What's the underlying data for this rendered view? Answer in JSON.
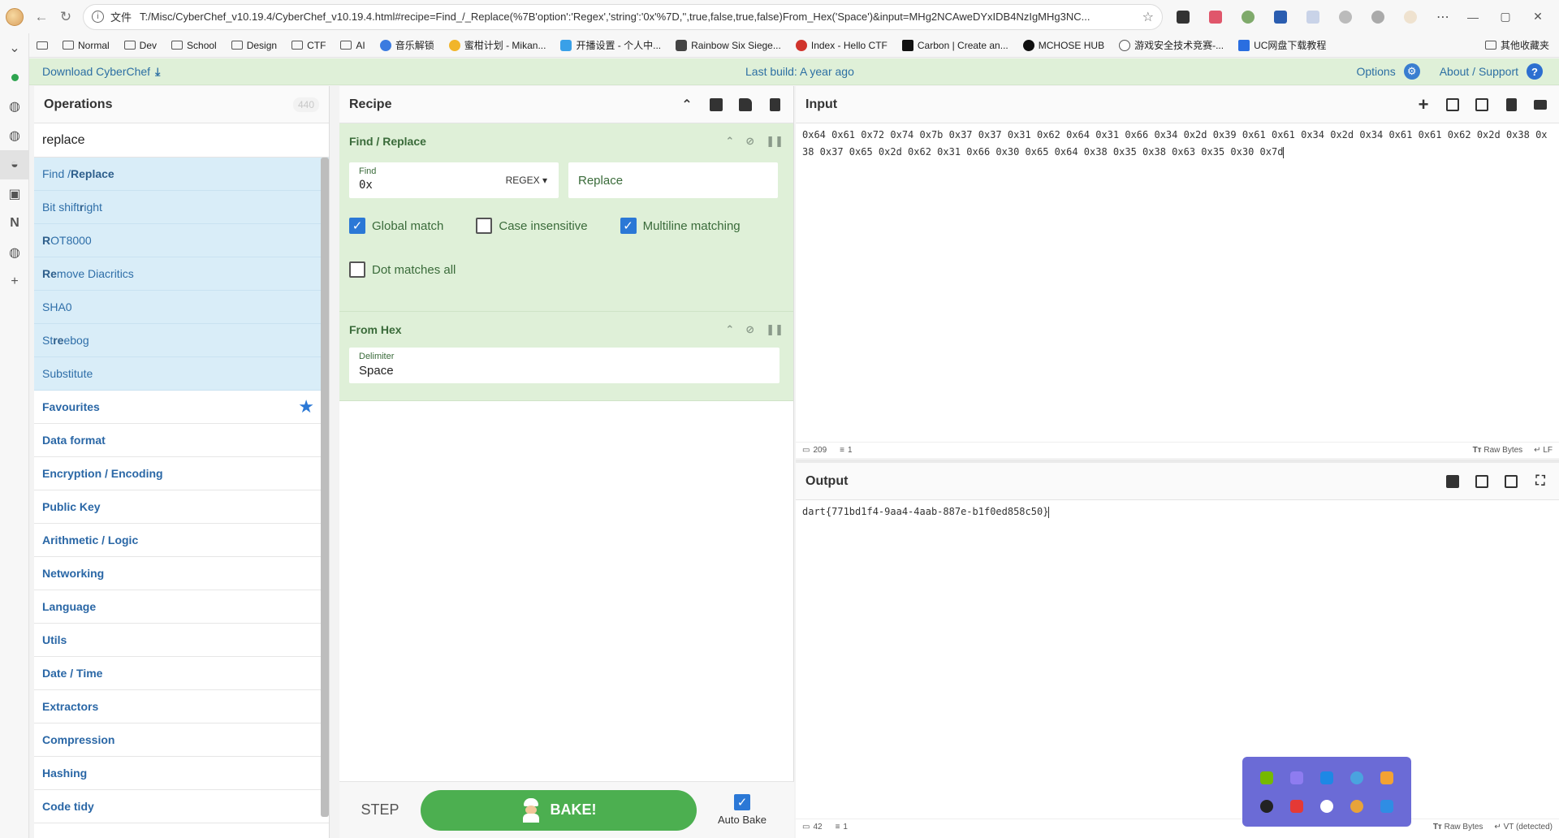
{
  "browser": {
    "address_label": "文件",
    "url": "T:/Misc/CyberChef_v10.19.4/CyberChef_v10.19.4.html#recipe=Find_/_Replace(%7B'option':'Regex','string':'0x'%7D,'',true,false,true,false)From_Hex('Space')&input=MHg2NCAweDYxIDB4NzIgMHg3NC..."
  },
  "bookmarks": [
    {
      "label": "Normal",
      "icon": "folder-icon"
    },
    {
      "label": "Dev",
      "icon": "folder-icon"
    },
    {
      "label": "School",
      "icon": "folder-icon"
    },
    {
      "label": "Design",
      "icon": "folder-icon"
    },
    {
      "label": "CTF",
      "icon": "folder-icon"
    },
    {
      "label": "AI",
      "icon": "folder-icon"
    },
    {
      "label": "音乐解锁",
      "icon": "music-icon"
    },
    {
      "label": "蜜柑计划 - Mikan...",
      "icon": "mikan-icon"
    },
    {
      "label": "开播设置 - 个人中...",
      "icon": "tv-icon"
    },
    {
      "label": "Rainbow Six Siege...",
      "icon": "shield-icon"
    },
    {
      "label": "Index - Hello CTF",
      "icon": "ctf-icon"
    },
    {
      "label": "Carbon | Create an...",
      "icon": "carbon-icon"
    },
    {
      "label": "MCHOSE HUB",
      "icon": "mchose-icon"
    },
    {
      "label": "游戏安全技术竞赛-...",
      "icon": "globe-icon"
    },
    {
      "label": "UC网盘下载教程",
      "icon": "uc-icon"
    }
  ],
  "bookmarks_other": "其他收藏夹",
  "banner": {
    "download": "Download CyberChef",
    "build": "Last build: A year ago",
    "options": "Options",
    "about": "About / Support"
  },
  "operations": {
    "title": "Operations",
    "count": "440",
    "search_value": "replace",
    "results": [
      {
        "pre": "Find / ",
        "hl": "Replace",
        "post": ""
      },
      {
        "pre": "Bit shift ",
        "hl": "r",
        "post": "ight"
      },
      {
        "pre": "",
        "hl": "R",
        "post": "OT8000"
      },
      {
        "pre": "",
        "hl": "Re",
        "post": "move Diacritics"
      },
      {
        "pre": "SHA0",
        "hl": "",
        "post": ""
      },
      {
        "pre": "St",
        "hl": "re",
        "post": "ebog"
      },
      {
        "pre": "Substitute",
        "hl": "",
        "post": ""
      }
    ],
    "categories": [
      "Favourites",
      "Data format",
      "Encryption / Encoding",
      "Public Key",
      "Arithmetic / Logic",
      "Networking",
      "Language",
      "Utils",
      "Date / Time",
      "Extractors",
      "Compression",
      "Hashing",
      "Code tidy"
    ]
  },
  "recipe": {
    "title": "Recipe",
    "find_replace": {
      "title": "Find / Replace",
      "find_label": "Find",
      "find_value": "0x",
      "find_mode": "REGEX",
      "replace_placeholder": "Replace",
      "global_match": "Global match",
      "case_insensitive": "Case insensitive",
      "multiline": "Multiline matching",
      "dot_all": "Dot matches all"
    },
    "from_hex": {
      "title": "From Hex",
      "delimiter_label": "Delimiter",
      "delimiter_value": "Space"
    },
    "step": "STEP",
    "bake": "BAKE!",
    "auto_bake": "Auto Bake"
  },
  "input": {
    "title": "Input",
    "text": "0x64 0x61 0x72 0x74 0x7b 0x37 0x37 0x31 0x62 0x64 0x31 0x66 0x34 0x2d 0x39 0x61 0x61 0x34 0x2d 0x34 0x61 0x61 0x62 0x2d 0x38 0x38 0x37 0x65 0x2d 0x62 0x31 0x66 0x30 0x65 0x64 0x38 0x35 0x38 0x63 0x35 0x30 0x7d",
    "length": "209",
    "lines": "1",
    "raw_bytes": "Raw Bytes",
    "eol": "LF"
  },
  "output": {
    "title": "Output",
    "text": "dart{771bd1f4-9aa4-4aab-887e-b1f0ed858c50}",
    "length": "42",
    "lines": "1",
    "raw_bytes": "Raw Bytes",
    "eol": "VT (detected)"
  },
  "colors": {
    "accent_blue": "#2b78d6",
    "bake_green": "#4caf50",
    "recipe_bg": "#dff0d8",
    "highlight_bg": "#d9edf8"
  }
}
